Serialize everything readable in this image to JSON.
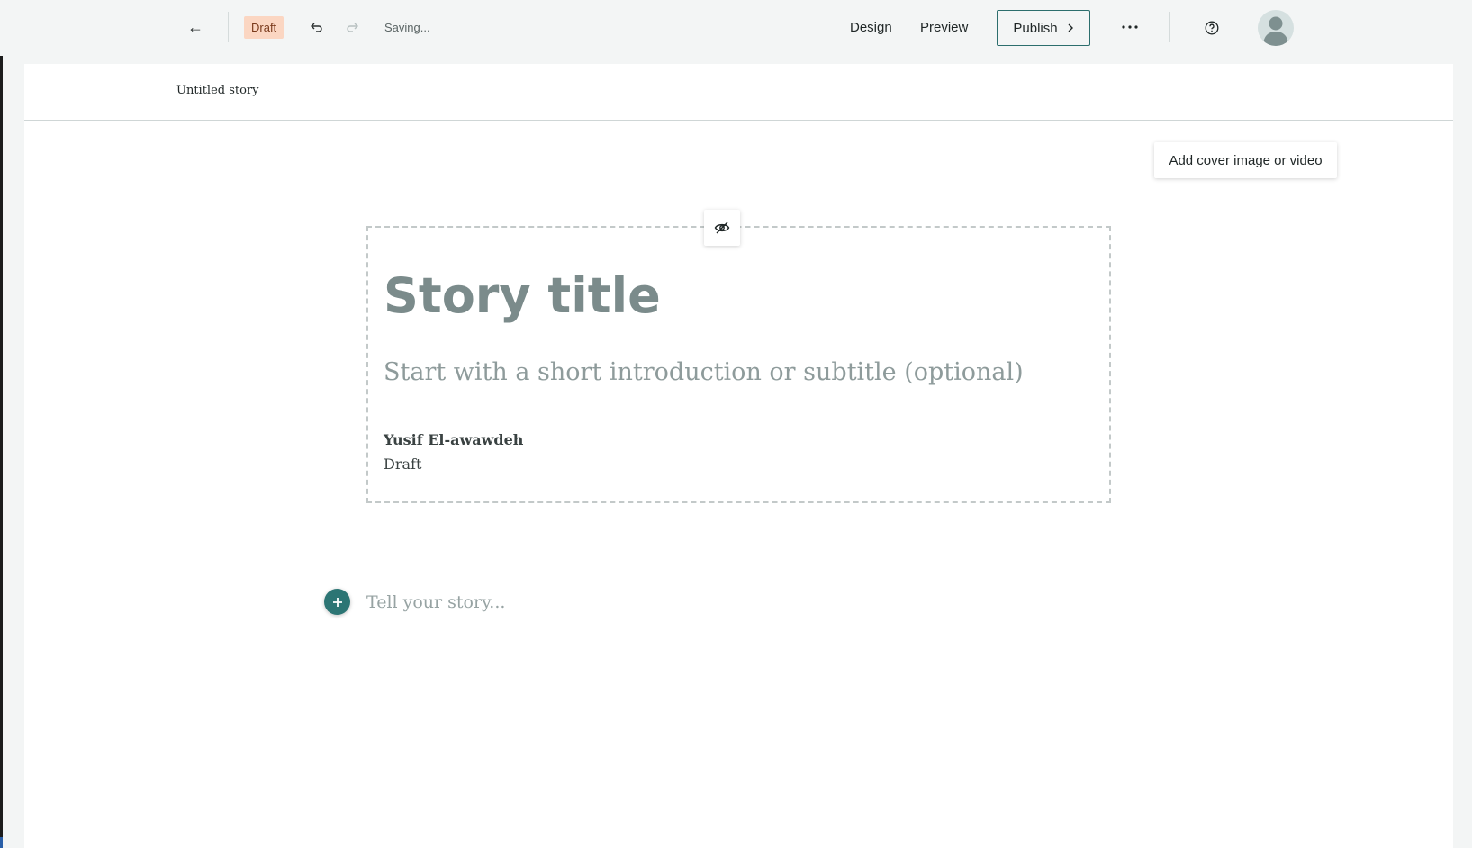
{
  "toolbar": {
    "back_icon": "arrow-left-icon",
    "status_badge": "Draft",
    "undo_icon": "undo-icon",
    "redo_icon": "redo-icon",
    "saving_status": "Saving...",
    "design_label": "Design",
    "preview_label": "Preview",
    "publish_label": "Publish",
    "more_icon": "more-horizontal-icon",
    "help_icon": "help-circle-icon",
    "avatar_icon": "user-avatar-icon"
  },
  "story": {
    "name": "Untitled story",
    "cover_button_label": "Add cover image or video",
    "title_placeholder": "Story title",
    "subtitle_placeholder": "Start with a short introduction or subtitle (optional)",
    "author": "Yusif El-awawdeh",
    "author_status": "Draft",
    "body_placeholder": "Tell your story..."
  },
  "colors": {
    "accent": "#2c7574",
    "draft_badge_bg": "#fbd6c2",
    "toolbar_bg": "#f3f5f5"
  }
}
